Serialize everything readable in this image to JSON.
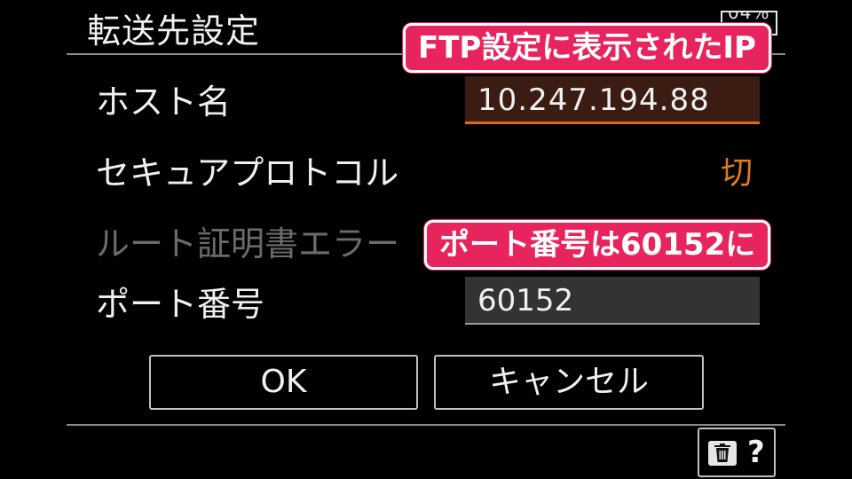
{
  "header": {
    "title": "転送先設定",
    "battery": "04%"
  },
  "form": {
    "host_label": "ホスト名",
    "host_value": "10.247.194.88",
    "secure_label": "セキュアプロトコル",
    "secure_value": "切",
    "cert_error_label": "ルート証明書エラー",
    "port_label": "ポート番号",
    "port_value": "60152"
  },
  "buttons": {
    "ok": "OK",
    "cancel": "キャンセル"
  },
  "footer": {
    "help": "?",
    "trash_icon": "trash-icon"
  },
  "annotations": {
    "ip_note": "FTP設定に表示されたIP",
    "port_note": "ポート番号は60152に"
  },
  "colors": {
    "accent_orange": "#e06a1a",
    "callout_pink": "#e8245e",
    "background": "#000000"
  }
}
